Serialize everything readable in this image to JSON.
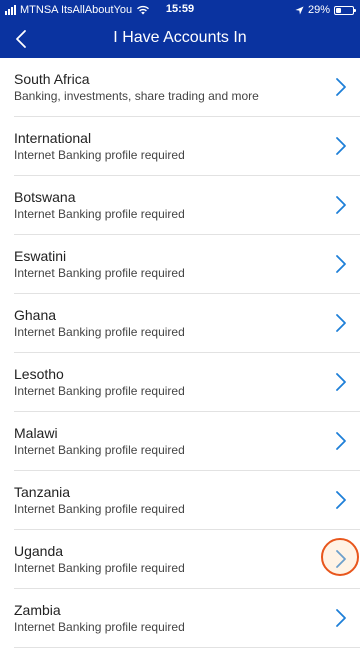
{
  "status_bar": {
    "carrier": "MTNSA ItsAllAboutYou",
    "time": "15:59",
    "battery": "29%",
    "battery_level": 0.29
  },
  "header": {
    "title": "I Have Accounts In",
    "back_icon": "chevron-left-icon"
  },
  "accent_color": "#0a33a0",
  "chevron_color": "#1e7fd8",
  "accounts": [
    {
      "title": "South Africa",
      "subtitle": "Banking, investments, share trading and more"
    },
    {
      "title": "International",
      "subtitle": "Internet Banking profile required"
    },
    {
      "title": "Botswana",
      "subtitle": "Internet Banking profile required"
    },
    {
      "title": "Eswatini",
      "subtitle": "Internet Banking profile required"
    },
    {
      "title": "Ghana",
      "subtitle": "Internet Banking profile required"
    },
    {
      "title": "Lesotho",
      "subtitle": "Internet Banking profile required"
    },
    {
      "title": "Malawi",
      "subtitle": "Internet Banking profile required"
    },
    {
      "title": "Tanzania",
      "subtitle": "Internet Banking profile required"
    },
    {
      "title": "Uganda",
      "subtitle": "Internet Banking profile required"
    },
    {
      "title": "Zambia",
      "subtitle": "Internet Banking profile required"
    }
  ]
}
